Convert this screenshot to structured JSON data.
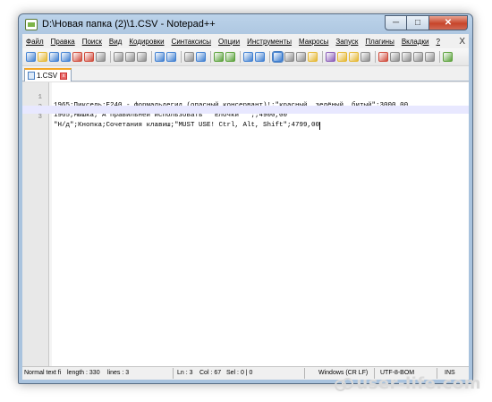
{
  "window": {
    "title": "D:\\Новая папка (2)\\1.CSV - Notepad++",
    "minimize_glyph": "─",
    "maximize_glyph": "□",
    "close_glyph": "✕"
  },
  "menu": {
    "items": [
      "Файл",
      "Правка",
      "Поиск",
      "Вид",
      "Кодировки",
      "Синтаксисы",
      "Опции",
      "Инструменты",
      "Макросы",
      "Запуск",
      "Плагины",
      "Вкладки",
      "?"
    ],
    "close_glyph": "X"
  },
  "toolbar": {
    "icons": [
      "new-file-icon",
      "open-file-icon",
      "save-icon",
      "save-all-icon",
      "close-icon",
      "close-all-icon",
      "print-icon",
      "cut-icon",
      "copy-icon",
      "paste-icon",
      "undo-icon",
      "redo-icon",
      "find-icon",
      "replace-icon",
      "zoom-in-icon",
      "zoom-out-icon",
      "sync-vertical-icon",
      "sync-horizontal-icon",
      "word-wrap-icon",
      "show-all-chars-icon",
      "indent-guide-icon",
      "language-icon",
      "doc-map-icon",
      "function-list-icon",
      "folder-workspace-icon",
      "monitoring-icon",
      "record-macro-icon",
      "stop-record-icon",
      "play-macro-icon",
      "run-macro-multiple-icon",
      "save-macro-icon",
      "plugin-icon"
    ],
    "colors": {
      "blue": "#3f7fd1",
      "green": "#5aa13a",
      "yellow": "#e5b731",
      "red": "#d04a3a",
      "gray": "#8b8b8b",
      "purple": "#8a5cb8"
    }
  },
  "tabs": [
    {
      "label": "1.CSV",
      "close_glyph": "x"
    }
  ],
  "editor": {
    "lines": [
      {
        "num": "1",
        "text": "1965;Пиксель;E240 - формальдегид (опасный консервант)!;\"красный, зелёный, битый\";3000,00"
      },
      {
        "num": "2",
        "text": "1965;Мышка;\"А правильней использовать \"\"Ёлочки\"\"\";;4900,00"
      },
      {
        "num": "3",
        "text": "\"Н/д\";Кнопка;Сочетания клавиш;\"MUST USE! Ctrl, Alt, Shift\";4799,00"
      }
    ],
    "current_line": 3
  },
  "status": {
    "type": "Normal text fi",
    "length": "length : 330",
    "lines": "lines : 3",
    "ln": "Ln : 3",
    "col": "Col : 67",
    "sel": "Sel : 0 | 0",
    "eol": "Windows (CR LF)",
    "encoding": "UTF-8-BOM",
    "mode": "INS"
  },
  "watermark": {
    "text": "user-life.com"
  }
}
